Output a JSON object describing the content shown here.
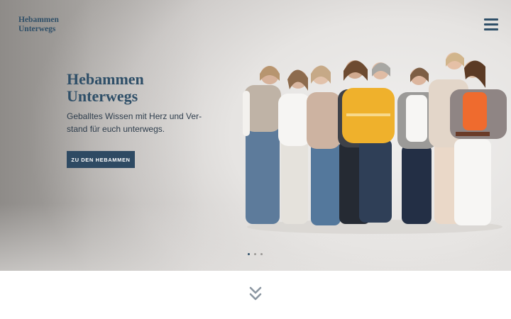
{
  "header": {
    "logo_line1": "Hebammen",
    "logo_line2": "Unterwegs",
    "menu_icon": "hamburger-menu-icon"
  },
  "hero": {
    "title_line1": "Hebammen",
    "title_line2": "Unterwegs",
    "subtitle": "Geballtes Wissen mit Herz und Ver-stand für euch unterwegs.",
    "cta_label": "ZU DEN HEBAMMEN",
    "image": "group-photo-of-midwives",
    "slider_dots": 3,
    "active_slide": 1
  },
  "below": {
    "scroll_icon": "double-chevron-down-icon"
  },
  "colors": {
    "brand": "#2f4f68",
    "button_bg": "#2e4a63",
    "button_text": "#ffffff"
  }
}
